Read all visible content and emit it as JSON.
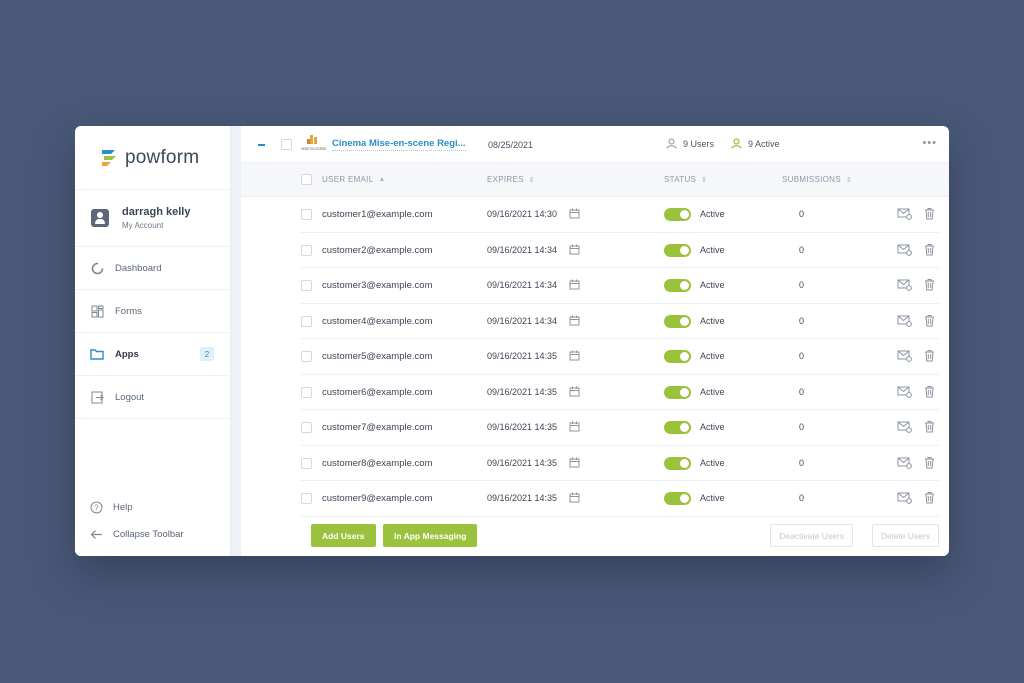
{
  "brand": {
    "name": "powform"
  },
  "profile": {
    "name": "darragh kelly",
    "subtitle": "My Account"
  },
  "nav": {
    "items": [
      {
        "label": "Dashboard",
        "icon": "dashboard-ring-icon"
      },
      {
        "label": "Forms",
        "icon": "forms-grid-icon"
      },
      {
        "label": "Apps",
        "icon": "folder-icon",
        "badge": "2",
        "active": true
      },
      {
        "label": "Logout",
        "icon": "logout-icon"
      }
    ],
    "help_label": "Help",
    "collapse_label": "Collapse Toolbar"
  },
  "app": {
    "name": "Cinema Mise-en-scene Regi...",
    "date": "08/25/2021",
    "users_count": "9 Users",
    "active_count": "9 Active",
    "logo_caption": "MISE EN SCENE"
  },
  "table": {
    "headers": {
      "email": "USER EMAIL",
      "expires": "EXPIRES",
      "status": "STATUS",
      "submissions": "SUBMISSIONS"
    },
    "rows": [
      {
        "email": "customer1@example.com",
        "expires": "09/16/2021 14:30",
        "status": "Active",
        "submissions": "0"
      },
      {
        "email": "customer2@example.com",
        "expires": "09/16/2021 14:34",
        "status": "Active",
        "submissions": "0"
      },
      {
        "email": "customer3@example.com",
        "expires": "09/16/2021 14:34",
        "status": "Active",
        "submissions": "0"
      },
      {
        "email": "customer4@example.com",
        "expires": "09/16/2021 14:34",
        "status": "Active",
        "submissions": "0"
      },
      {
        "email": "customer5@example.com",
        "expires": "09/16/2021 14:35",
        "status": "Active",
        "submissions": "0"
      },
      {
        "email": "customer6@example.com",
        "expires": "09/16/2021 14:35",
        "status": "Active",
        "submissions": "0"
      },
      {
        "email": "customer7@example.com",
        "expires": "09/16/2021 14:35",
        "status": "Active",
        "submissions": "0"
      },
      {
        "email": "customer8@example.com",
        "expires": "09/16/2021 14:35",
        "status": "Active",
        "submissions": "0"
      },
      {
        "email": "customer9@example.com",
        "expires": "09/16/2021 14:35",
        "status": "Active",
        "submissions": "0"
      }
    ]
  },
  "footer": {
    "add_users": "Add Users",
    "in_app_messaging": "In App Messaging",
    "deactivate_users": "Deactivate Users",
    "delete_users": "Delete Users"
  },
  "colors": {
    "background": "#4a5878",
    "accent_blue": "#2a8fc5",
    "accent_green": "#9ac23c"
  }
}
